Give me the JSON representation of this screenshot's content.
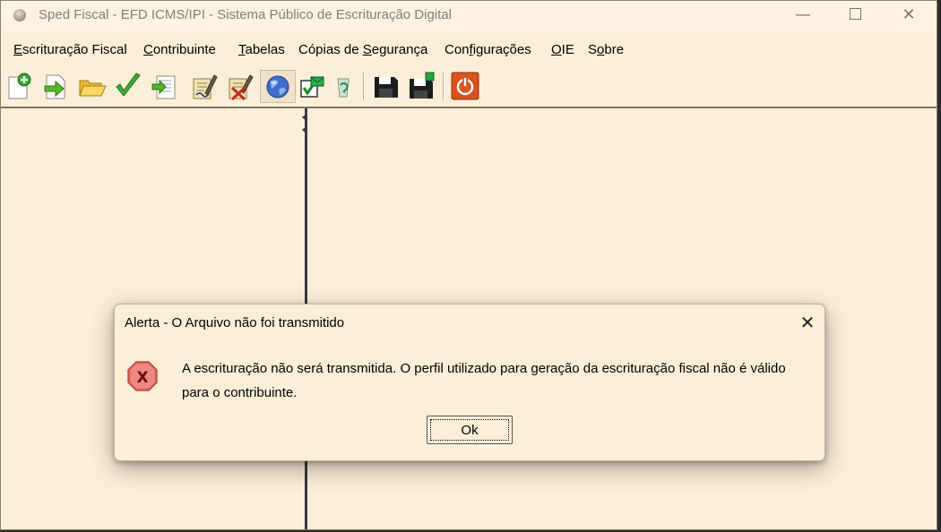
{
  "window": {
    "title": "Sped Fiscal - EFD ICMS/IPI - Sistema Público de Escrituração Digital",
    "minimize_glyph": "—",
    "close_glyph": "✕"
  },
  "menu": [
    {
      "id": "escrituracao-fiscal",
      "pre": "",
      "accel": "E",
      "post": "scrituração Fiscal"
    },
    {
      "id": "contribuinte",
      "pre": "",
      "accel": "C",
      "post": "ontribuinte"
    },
    {
      "id": "tabelas",
      "pre": "",
      "accel": "T",
      "post": "abelas"
    },
    {
      "id": "copias-de-seguranca",
      "pre": "Cópias de ",
      "accel": "S",
      "post": "egurança"
    },
    {
      "id": "configuracoes",
      "pre": "Con",
      "accel": "f",
      "post": "igurações"
    },
    {
      "id": "oie",
      "pre": "",
      "accel": "O",
      "post": "IE"
    },
    {
      "id": "sobre",
      "pre": "S",
      "accel": "o",
      "post": "bre"
    }
  ],
  "toolbar": {
    "icons": [
      "new-file-icon",
      "import-arrow-icon",
      "open-folder-icon",
      "validate-check-icon",
      "export-document-icon",
      "sign-document-icon",
      "remove-signature-icon",
      "transmit-globe-icon",
      "checkbox-envelope-icon",
      "recycle-icon",
      "save-disk-icon",
      "save-disk-new-icon",
      "power-exit-icon"
    ],
    "pressed": "transmit-globe-icon"
  },
  "dialog": {
    "title": "Alerta - O Arquivo não foi transmitido",
    "close_glyph": "✕",
    "icon": "error-x-icon",
    "message_line1": "A escrituração não será transmitida. O perfil utilizado para geração da escrituração fiscal não é válido",
    "message_line2": "para o contribuinte.",
    "ok_label": "Ok"
  },
  "colors": {
    "background": "#fcefd8",
    "error_icon": "#e05a55",
    "power_button": "#d8531f"
  }
}
